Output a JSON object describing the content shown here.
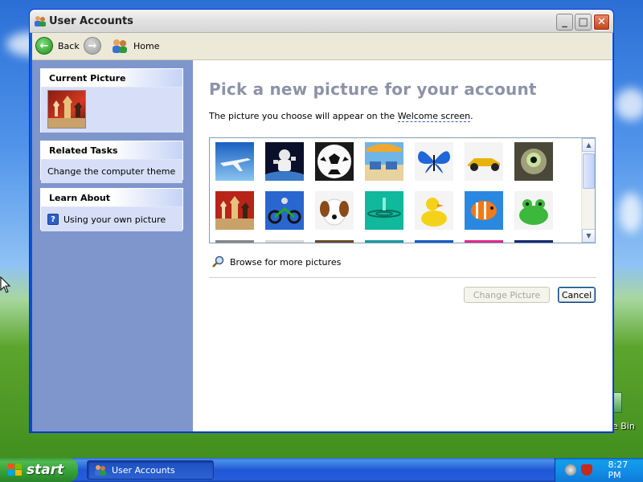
{
  "window": {
    "title": "User Accounts",
    "buttons": {
      "minimize": "_",
      "maximize": "□",
      "close": "✕"
    }
  },
  "toolbar": {
    "back_label": "Back",
    "forward_label": "",
    "home_label": "Home"
  },
  "sidebar": {
    "current_picture": {
      "header": "Current Picture",
      "picture": "chess"
    },
    "related_tasks": {
      "header": "Related Tasks",
      "items": [
        "Change the computer theme"
      ]
    },
    "learn_about": {
      "header": "Learn About",
      "items": [
        "Using your own picture"
      ]
    }
  },
  "main": {
    "heading": "Pick a new picture for your account",
    "subtitle_prefix": "The picture you choose will appear on the ",
    "subtitle_link": "Welcome screen",
    "subtitle_suffix": ".",
    "pictures": [
      "airplane",
      "astronaut",
      "soccer ball",
      "beach",
      "butterfly",
      "car",
      "cat",
      "chess",
      "dirt bike",
      "dog",
      "drip",
      "duck",
      "fish",
      "frog"
    ],
    "browse_label": "Browse for more pictures",
    "change_button": "Change Picture",
    "cancel_button": "Cancel"
  },
  "desktop": {
    "recycle_bin_label": "Recycle Bin",
    "recycle_bin_visible_text": "e Bin"
  },
  "taskbar": {
    "start_label": "start",
    "task_item": "User Accounts",
    "clock": "8:27 PM"
  },
  "colors": {
    "heading": "#8c93a6",
    "sidebar_bg": "#7f96cc",
    "title_bar": "#e3e3e3"
  }
}
